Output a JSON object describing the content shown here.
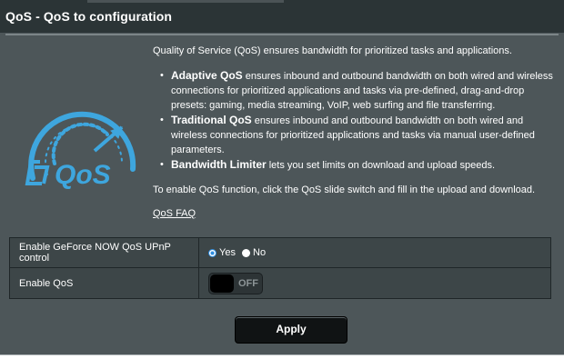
{
  "header": {
    "title": "QoS - QoS to configuration"
  },
  "description": {
    "intro": "Quality of Service (QoS) ensures bandwidth for prioritized tasks and applications.",
    "features": [
      {
        "name": "Adaptive QoS",
        "text": " ensures inbound and outbound bandwidth on both wired and wireless connections for prioritized applications and tasks via pre-defined, drag-and-drop presets: gaming, media streaming, VoIP, web surfing and file transferring."
      },
      {
        "name": "Traditional QoS",
        "text": " ensures inbound and outbound bandwidth on both wired and wireless connections for prioritized applications and tasks via manual user-defined parameters."
      },
      {
        "name": "Bandwidth Limiter",
        "text": " lets you set limits on download and upload speeds."
      }
    ],
    "enable_text": "To enable QoS function, click the QoS slide switch and fill in the upload and download.",
    "faq_link": "QoS FAQ"
  },
  "settings": {
    "geforce": {
      "label": "Enable GeForce NOW QoS UPnP control",
      "options": [
        "Yes",
        "No"
      ],
      "selected": "Yes"
    },
    "enable_qos": {
      "label": "Enable QoS",
      "state": "OFF"
    }
  },
  "actions": {
    "apply_label": "Apply"
  },
  "colors": {
    "panel_bg": "#4d5659",
    "title_bg": "#2b3436",
    "logo_blue": "#3ea6de",
    "radio_selected": "#2f8ee0"
  },
  "icons": {
    "logo": "qos-speedometer-logo"
  }
}
